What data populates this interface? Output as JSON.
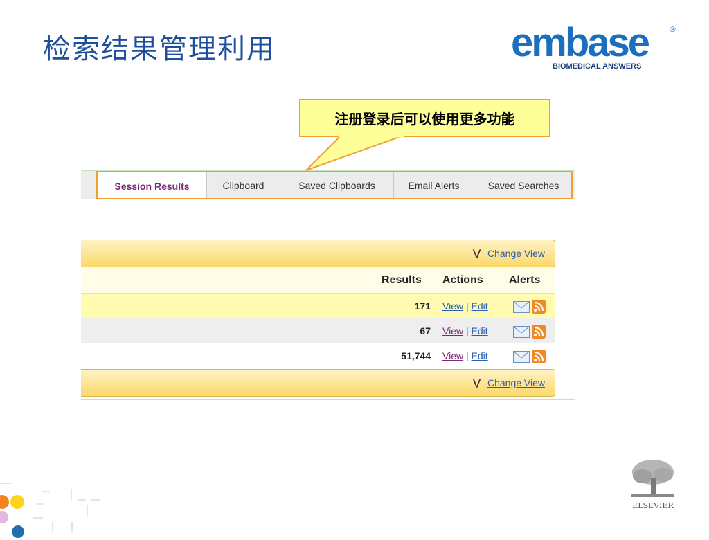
{
  "slide": {
    "title": "检索结果管理利用",
    "callout": "注册登录后可以使用更多功能"
  },
  "logo": {
    "word": "embase",
    "reg": "®",
    "tagline": "BIOMEDICAL ANSWERS"
  },
  "elsevier": {
    "label": "ELSEVIER"
  },
  "tabs": [
    {
      "label": "Session Results",
      "active": true
    },
    {
      "label": "Clipboard"
    },
    {
      "label": "Saved Clipboards"
    },
    {
      "label": "Email Alerts"
    },
    {
      "label": "Saved Searches"
    }
  ],
  "toolbar": {
    "change_view": "Change View"
  },
  "table": {
    "headers": {
      "results": "Results",
      "actions": "Actions",
      "alerts": "Alerts"
    },
    "action_view": "View",
    "action_sep": "|",
    "action_edit": "Edit",
    "rows": [
      {
        "count": "171",
        "bg": "#fffbb0"
      },
      {
        "count": "67",
        "bg": "#eeeeee"
      },
      {
        "count": "51,744",
        "bg": "#ffffff"
      }
    ]
  },
  "colors": {
    "title": "#1f4f9c",
    "callout_bg": "#ffff99",
    "highlight": "#f0a030",
    "link": "#2a5fb0",
    "visited_link": "#7a2a7a"
  }
}
